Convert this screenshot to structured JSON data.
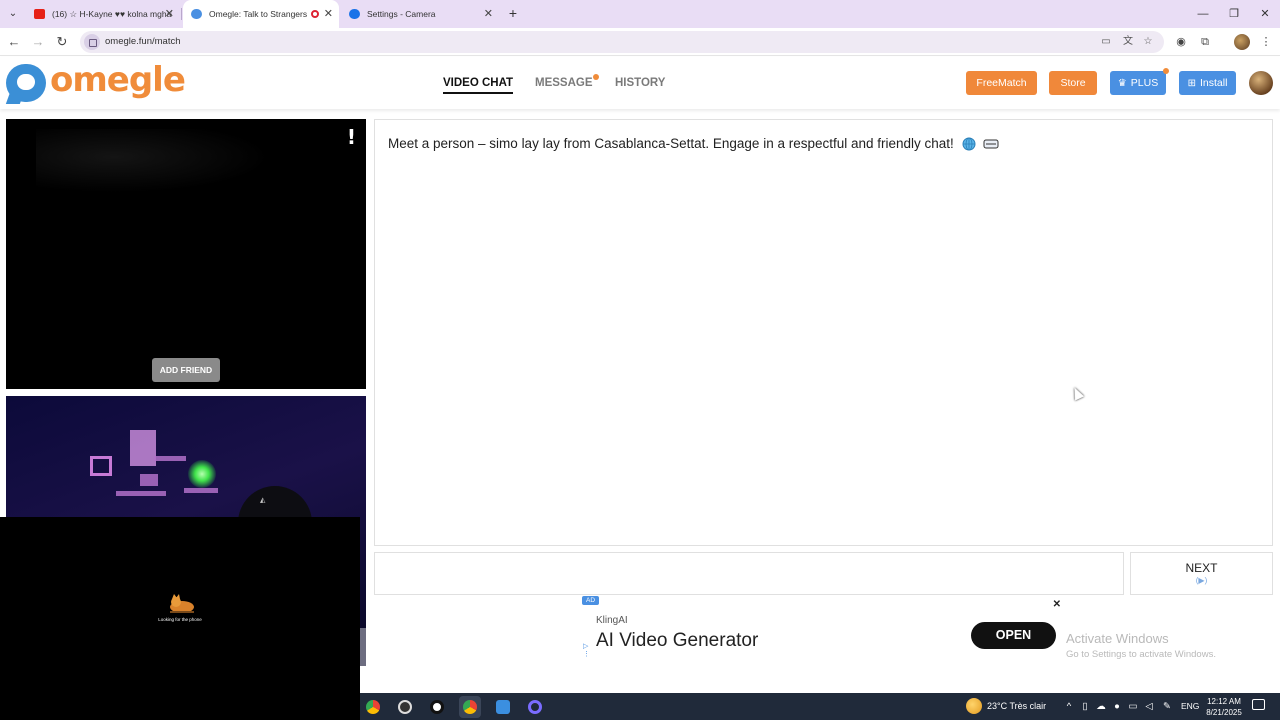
{
  "browser": {
    "tabs": [
      {
        "title": "(16) ☆ H-Kayne ♥♥ kolna mghal",
        "favicon_color": "#e62117"
      },
      {
        "title": "Omegle: Talk to Strangers v",
        "favicon_color": "#4a90e2"
      },
      {
        "title": "Settings - Camera",
        "favicon_color": "#1a73e8"
      }
    ],
    "active_tab": 1,
    "url": "omegle.fun/match"
  },
  "site": {
    "logo_text": "omegle",
    "nav": [
      {
        "label": "VIDEO CHAT",
        "active": true
      },
      {
        "label": "MESSAGE",
        "has_dot": true
      },
      {
        "label": "HISTORY"
      }
    ],
    "buttons": {
      "freematch": "FreeMatch",
      "store": "Store",
      "plus": "PLUS",
      "install": "Install"
    }
  },
  "video": {
    "add_friend": "ADD FRIEND",
    "report_glyph": "!",
    "looking_text": "Looking for the phone"
  },
  "chat": {
    "message": "Meet a person – simo lay lay from Casablanca-Settat. Engage in a respectful and friendly chat!",
    "next_label": "NEXT",
    "next_sub": "(▶)"
  },
  "ad": {
    "badge": "AD",
    "brand": "KlingAI",
    "title": "AI Video Generator",
    "cta": "OPEN"
  },
  "activation": {
    "title": "Activate Windows",
    "subtitle": "Go to Settings to activate Windows."
  },
  "taskbar": {
    "weather": "23°C  Très clair",
    "language": "ENG",
    "time": "12:12 AM",
    "date": "8/21/2025"
  },
  "colors": {
    "accent_orange": "#f0883a",
    "accent_blue": "#4a90e2",
    "logo_blue": "#3b8fd6"
  }
}
